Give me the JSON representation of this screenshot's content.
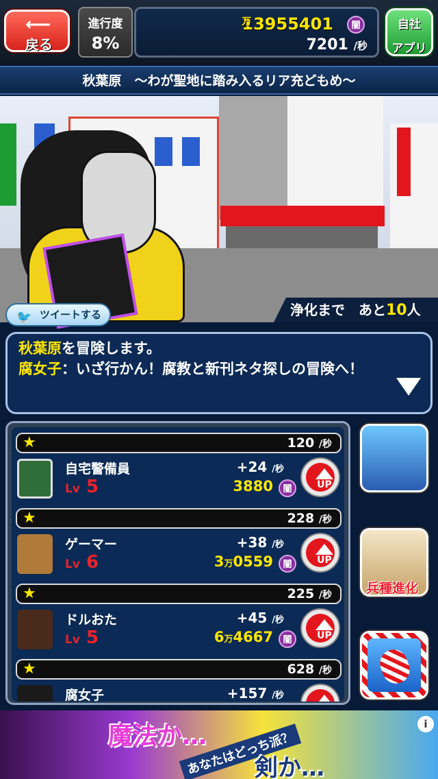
{
  "header": {
    "back_label": "戻る",
    "progress_title": "進行度",
    "progress_value": "8%",
    "money_main": "1395",
    "money_unit": "万",
    "money_sub": "5401",
    "currency_icon": "闇",
    "rate_value": "7201",
    "rate_unit": "/秒",
    "app_line1": "自社",
    "app_line2": "アプリ"
  },
  "stage": {
    "title": "秋葉原　〜わが聖地に踏み入るリア充どもめ〜",
    "purify_prefix": "浄化まで　あと",
    "purify_count": "10",
    "purify_suffix": "人",
    "tweet_label": "ツイートする"
  },
  "message": {
    "place": "秋葉原",
    "line1_rest": "を冒険します。",
    "speaker": "腐女子",
    "line2_rest": "：いざ行かん！腐教と新刊ネタ探しの冒険へ！"
  },
  "units": [
    {
      "total": "120",
      "total_unit": "/秒",
      "name": "自宅警備員",
      "lv_label": "Lv",
      "lv": "5",
      "rate": "+24",
      "rate_unit": "/秒",
      "cost": "3880",
      "cost_badge": "闇",
      "up_label": "UP"
    },
    {
      "total": "228",
      "total_unit": "/秒",
      "name": "ゲーマー",
      "lv_label": "Lv",
      "lv": "6",
      "rate": "+38",
      "rate_unit": "/秒",
      "cost_pre": "3",
      "cost_man": "万",
      "cost": "0559",
      "cost_badge": "闇",
      "up_label": "UP"
    },
    {
      "total": "225",
      "total_unit": "/秒",
      "name": "ドルおた",
      "lv_label": "Lv",
      "lv": "5",
      "rate": "+45",
      "rate_unit": "/秒",
      "cost_pre": "6",
      "cost_man": "万",
      "cost": "4667",
      "cost_badge": "闇",
      "up_label": "UP"
    },
    {
      "total": "628",
      "total_unit": "/秒",
      "name": "腐女子",
      "rate": "+157",
      "rate_unit": "/秒"
    }
  ],
  "side": {
    "evolve_label": "兵種進化"
  },
  "ad": {
    "text1": "魔法か…",
    "text2": "あなたはどっち派？",
    "text3": "剣か…",
    "info": "i"
  },
  "colors": {
    "accent_yellow": "#ffe600",
    "back_red": "#d8231c",
    "app_green": "#1e9c34",
    "panel_navy": "#0b2a55"
  }
}
